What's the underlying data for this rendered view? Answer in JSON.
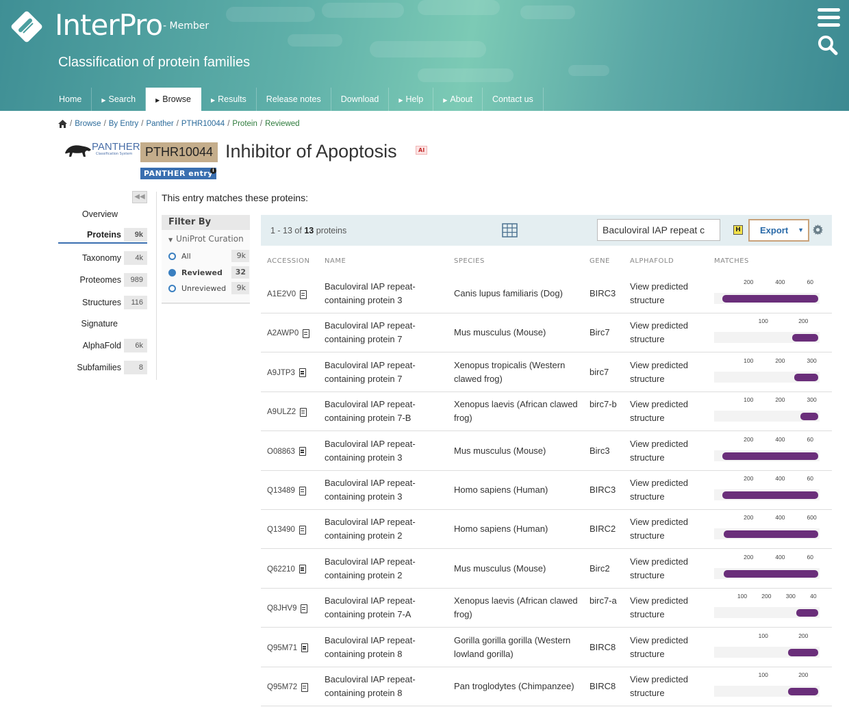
{
  "header": {
    "logo_text": "InterPro",
    "logo_sub": "- Member",
    "tagline": "Classification of protein families",
    "nav": [
      {
        "label": "Home",
        "caret": false,
        "active": false
      },
      {
        "label": "Search",
        "caret": true,
        "active": false
      },
      {
        "label": "Browse",
        "caret": true,
        "active": true
      },
      {
        "label": "Results",
        "caret": true,
        "active": false
      },
      {
        "label": "Release notes",
        "caret": false,
        "active": false
      },
      {
        "label": "Download",
        "caret": false,
        "active": false
      },
      {
        "label": "Help",
        "caret": true,
        "active": false
      },
      {
        "label": "About",
        "caret": true,
        "active": false
      },
      {
        "label": "Contact us",
        "caret": false,
        "active": false
      }
    ]
  },
  "breadcrumb": {
    "items": [
      "Browse",
      "By Entry",
      "Panther",
      "PTHR10044"
    ],
    "current": [
      "Protein",
      "Reviewed"
    ]
  },
  "entry": {
    "accession": "PTHR10044",
    "title": "Inhibitor of Apoptosis",
    "ai_badge": "AI",
    "type_badge": "PANTHER entry",
    "logo_text": "PANTHER",
    "logo_sub": "Classification System"
  },
  "sidebar": {
    "items": [
      {
        "label": "Overview",
        "count": ""
      },
      {
        "label": "Proteins",
        "count": "9k"
      },
      {
        "label": "Taxonomy",
        "count": "4k"
      },
      {
        "label": "Proteomes",
        "count": "989"
      },
      {
        "label": "Structures",
        "count": "116"
      },
      {
        "label": "Signature",
        "count": ""
      },
      {
        "label": "AlphaFold",
        "count": "6k"
      },
      {
        "label": "Subfamilies",
        "count": "8"
      }
    ]
  },
  "intro": "This entry matches these proteins:",
  "filter": {
    "title": "Filter By",
    "group": "UniProt Curation",
    "options": [
      {
        "label": "All",
        "count": "9k",
        "selected": false
      },
      {
        "label": "Reviewed",
        "count": "32",
        "selected": true
      },
      {
        "label": "Unreviewed",
        "count": "9k",
        "selected": false
      }
    ]
  },
  "toolbar": {
    "range": "1 - 13 of",
    "total": "13",
    "unit": "proteins",
    "search_value": "Baculoviral IAP repeat c",
    "h_label": "H",
    "export_label": "Export"
  },
  "table": {
    "headers": [
      "ACCESSION",
      "NAME",
      "SPECIES",
      "GENE",
      "ALPHAFOLD",
      "MATCHES"
    ],
    "rows": [
      {
        "accession": "A1E2V0",
        "name": "Baculoviral IAP repeat-containing protein 3",
        "species": "Canis lupus familiaris (Dog)",
        "gene": "BIRC3",
        "alphafold": "View predicted structure",
        "ticks": [
          "200",
          "400",
          "60"
        ],
        "bar_start": 0.08,
        "bar_end": 0.99
      },
      {
        "accession": "A2AWP0",
        "name": "Baculoviral IAP repeat-containing protein 7",
        "species": "Mus musculus (Mouse)",
        "gene": "Birc7",
        "alphafold": "View predicted structure",
        "ticks": [
          "100",
          "200"
        ],
        "bar_start": 0.74,
        "bar_end": 0.99
      },
      {
        "accession": "A9JTP3",
        "name": "Baculoviral IAP repeat-containing protein 7",
        "species": "Xenopus tropicalis (Western clawed frog)",
        "gene": "birc7",
        "alphafold": "View predicted structure",
        "ticks": [
          "100",
          "200",
          "300"
        ],
        "bar_start": 0.76,
        "bar_end": 0.99
      },
      {
        "accession": "A9ULZ2",
        "name": "Baculoviral IAP repeat-containing protein 7-B",
        "species": "Xenopus laevis (African clawed frog)",
        "gene": "birc7-b",
        "alphafold": "View predicted structure",
        "ticks": [
          "100",
          "200",
          "300"
        ],
        "bar_start": 0.82,
        "bar_end": 0.99
      },
      {
        "accession": "O08863",
        "name": "Baculoviral IAP repeat-containing protein 3",
        "species": "Mus musculus (Mouse)",
        "gene": "Birc3",
        "alphafold": "View predicted structure",
        "ticks": [
          "200",
          "400",
          "60"
        ],
        "bar_start": 0.08,
        "bar_end": 0.99
      },
      {
        "accession": "Q13489",
        "name": "Baculoviral IAP repeat-containing protein 3",
        "species": "Homo sapiens (Human)",
        "gene": "BIRC3",
        "alphafold": "View predicted structure",
        "ticks": [
          "200",
          "400",
          "60"
        ],
        "bar_start": 0.08,
        "bar_end": 0.99
      },
      {
        "accession": "Q13490",
        "name": "Baculoviral IAP repeat-containing protein 2",
        "species": "Homo sapiens (Human)",
        "gene": "BIRC2",
        "alphafold": "View predicted structure",
        "ticks": [
          "200",
          "400",
          "600"
        ],
        "bar_start": 0.09,
        "bar_end": 0.99
      },
      {
        "accession": "Q62210",
        "name": "Baculoviral IAP repeat-containing protein 2",
        "species": "Mus musculus (Mouse)",
        "gene": "Birc2",
        "alphafold": "View predicted structure",
        "ticks": [
          "200",
          "400",
          "60"
        ],
        "bar_start": 0.09,
        "bar_end": 0.99
      },
      {
        "accession": "Q8JHV9",
        "name": "Baculoviral IAP repeat-containing protein 7-A",
        "species": "Xenopus laevis (African clawed frog)",
        "gene": "birc7-a",
        "alphafold": "View predicted structure",
        "ticks": [
          "100",
          "200",
          "300",
          "40"
        ],
        "bar_start": 0.78,
        "bar_end": 0.99
      },
      {
        "accession": "Q95M71",
        "name": "Baculoviral IAP repeat-containing protein 8",
        "species": "Gorilla gorilla gorilla (Western lowland gorilla)",
        "gene": "BIRC8",
        "alphafold": "View predicted structure",
        "ticks": [
          "100",
          "200"
        ],
        "bar_start": 0.7,
        "bar_end": 0.99
      },
      {
        "accession": "Q95M72",
        "name": "Baculoviral IAP repeat-containing protein 8",
        "species": "Pan troglodytes (Chimpanzee)",
        "gene": "BIRC8",
        "alphafold": "View predicted structure",
        "ticks": [
          "100",
          "200"
        ],
        "bar_start": 0.7,
        "bar_end": 0.99
      }
    ]
  },
  "colors": {
    "match_bar": "#6a2e7a",
    "accent": "#3a6fb0",
    "accession_badge": "#c4ad8b"
  },
  "icons": [
    "home-icon",
    "menu-icon",
    "search-icon",
    "table-view-icon",
    "settings-gear-icon",
    "document-icon",
    "info-icon",
    "collapse-sidebar-icon"
  ]
}
